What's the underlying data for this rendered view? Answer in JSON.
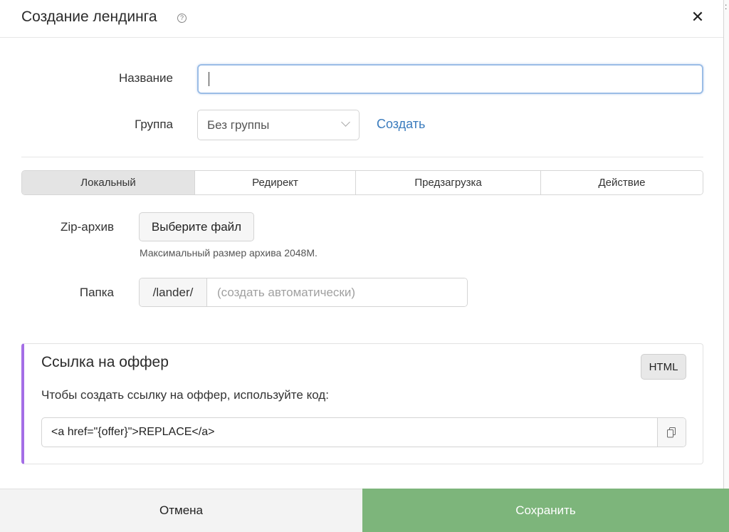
{
  "header": {
    "title": "Создание лендинга",
    "help_icon": "question-circle-icon",
    "close_icon": "close-icon",
    "close_symbol": "✕"
  },
  "form": {
    "name_label": "Название",
    "name_value": "",
    "group_label": "Группа",
    "group_selected": "Без группы",
    "create_link": "Создать"
  },
  "tabs": [
    {
      "label": "Локальный",
      "active": true
    },
    {
      "label": "Редирект",
      "active": false
    },
    {
      "label": "Предзагрузка",
      "active": false
    },
    {
      "label": "Действие",
      "active": false
    }
  ],
  "local": {
    "zip_label": "Zip-архив",
    "file_button": "Выберите файл",
    "size_hint": "Максимальный размер архива 2048M.",
    "folder_label": "Папка",
    "folder_prefix": "/lander/",
    "folder_placeholder": "(создать автоматически)"
  },
  "offer": {
    "title": "Ссылка на оффер",
    "html_button": "HTML",
    "description": "Чтобы создать ссылку на оффер, используйте код:",
    "code": "<a href=\"{offer}\">REPLACE</a>",
    "copy_icon": "copy-icon"
  },
  "footer": {
    "cancel": "Отмена",
    "save": "Сохранить"
  },
  "colors": {
    "accent_purple": "#a46ee6",
    "link_blue": "#3a7bbd",
    "save_green": "#7db57b",
    "focus_blue": "#9bbde6"
  }
}
